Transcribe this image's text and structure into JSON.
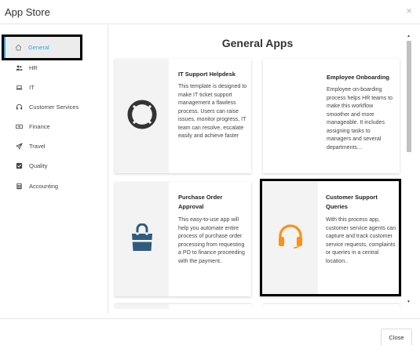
{
  "window": {
    "title": "App Store",
    "close_glyph": "×"
  },
  "sidebar": {
    "items": [
      {
        "label": "General",
        "icon": "home-icon"
      },
      {
        "label": "HR",
        "icon": "users-icon"
      },
      {
        "label": "IT",
        "icon": "laptop-icon"
      },
      {
        "label": "Customer Services",
        "icon": "headset-icon"
      },
      {
        "label": "Finance",
        "icon": "money-icon"
      },
      {
        "label": "Travel",
        "icon": "plane-icon"
      },
      {
        "label": "Quality",
        "icon": "check-square-icon"
      },
      {
        "label": "Accounting",
        "icon": "calculator-icon"
      }
    ],
    "active_index": 0
  },
  "main": {
    "title": "General Apps",
    "cards": [
      {
        "title": "IT Support Helpdesk",
        "description": "This template is designed to make IT ticket support management a flawless process. Users can raise issues, monitor progress, IT team can resolve, escalate easily and achieve faster",
        "icon": "lifebuoy-icon"
      },
      {
        "title": "Employee Onboarding",
        "description": "Employee on-boarding process helps HR teams to make this workflow smoother and more manageable. It includes assigning tasks to managers and several departments...",
        "icon": ""
      },
      {
        "title": "Purchase Order Approval",
        "description": "This easy-to-use app will help you automate entire process of purchase order processing from requesting a PO to finance proceeding with the payment..",
        "icon": "shopping-bag-icon"
      },
      {
        "title": "Customer Support Queries",
        "description": "With this process app, customer service agents can capture and track customer service requests, complaints or queries in a central location..",
        "icon": "headset-icon"
      }
    ]
  },
  "footer": {
    "close_label": "Close"
  },
  "colors": {
    "accent": "#2fa8e0",
    "headset": "#f7921e",
    "bag": "#2f5b7f",
    "lifebuoy": "#333333"
  }
}
